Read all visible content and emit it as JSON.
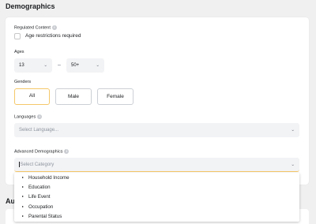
{
  "page_title": "Demographics",
  "regulated_content": {
    "label": "Regulated Content",
    "checkbox_label": "Age restrictions required",
    "checked": false
  },
  "ages": {
    "label": "Ages",
    "min": "13",
    "max": "50+",
    "separator": "–"
  },
  "genders": {
    "label": "Genders",
    "options": [
      "All",
      "Male",
      "Female"
    ],
    "selected": "All"
  },
  "languages": {
    "label": "Languages",
    "placeholder": "Select Language..."
  },
  "advanced_demographics": {
    "label": "Advanced Demographics",
    "placeholder": "Select Category",
    "options": [
      "Household Income",
      "Education",
      "Life Event",
      "Occupation",
      "Parental Status"
    ]
  },
  "next_section_title": "Au",
  "icons": {
    "info": "info-icon",
    "chevron": "chevron-down-icon",
    "expand": "expand-triangle-icon"
  },
  "colors": {
    "accent": "#f5c86a",
    "field_bg": "#f2f3f5",
    "page_bg": "#f0f0f0"
  }
}
